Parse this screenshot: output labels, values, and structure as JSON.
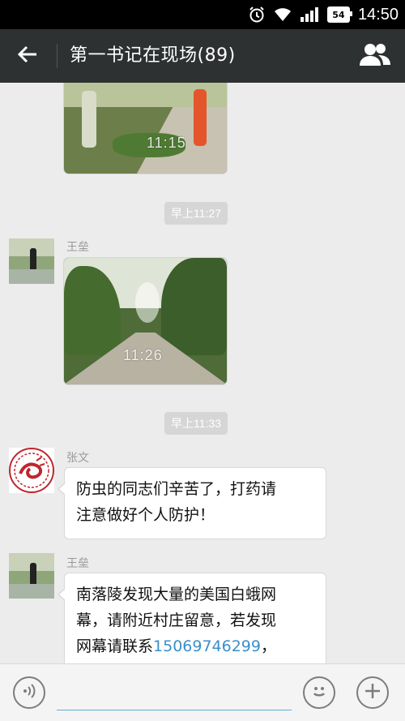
{
  "status_bar": {
    "battery_level": "54",
    "time": "14:50"
  },
  "header": {
    "title": "第一书记在现场(89)"
  },
  "messages": [
    {
      "type": "image",
      "timestamp_overlay": "11:15"
    },
    {
      "type": "time",
      "label": "早上11:27"
    },
    {
      "type": "image",
      "sender": "王垒",
      "timestamp_overlay": "11:26"
    },
    {
      "type": "time",
      "label": "早上11:33"
    },
    {
      "type": "text",
      "sender": "张文",
      "lines": [
        "防虫的同志们辛苦了，打药请",
        "注意做好个人防护！"
      ]
    },
    {
      "type": "text",
      "sender": "王垒",
      "lines": [
        "南落陵发现大量的美国白蛾网",
        "幕，请附近村庄留意，若发现"
      ],
      "line3_prefix": "网幕请联系",
      "phone": "15069746299",
      "line3_suffix": "，"
    }
  ],
  "icons": {
    "back": "arrow-left-icon",
    "members": "group-members-icon",
    "voice": "voice-input-icon",
    "emoji": "emoji-icon",
    "more": "plus-icon"
  }
}
